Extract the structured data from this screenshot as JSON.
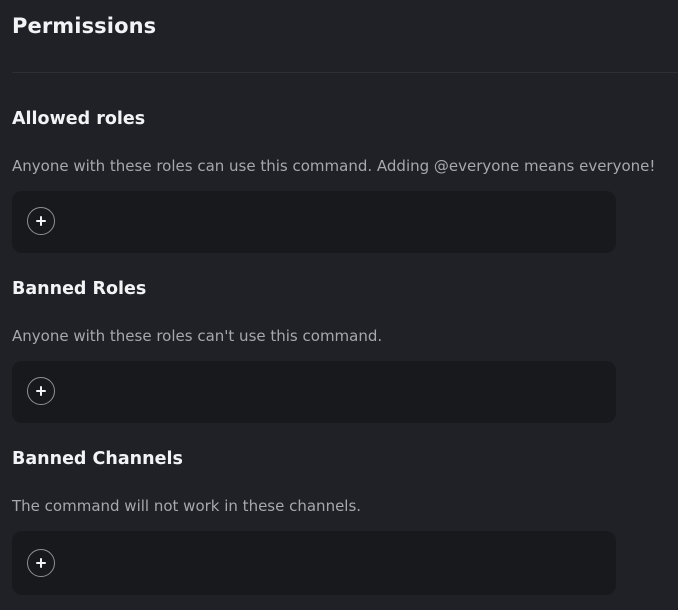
{
  "page": {
    "title": "Permissions"
  },
  "sections": [
    {
      "title": "Allowed roles",
      "description": "Anyone with these roles can use this command. Adding @everyone means everyone!",
      "add_icon": "plus-icon"
    },
    {
      "title": "Banned Roles",
      "description": "Anyone with these roles can't use this command.",
      "add_icon": "plus-icon"
    },
    {
      "title": "Banned Channels",
      "description": "The command will not work in these channels.",
      "add_icon": "plus-icon"
    }
  ],
  "colors": {
    "background": "#1f2126",
    "box": "#18191d",
    "text": "#f2f3f5",
    "muted_text": "#a6a8ad",
    "divider": "#2c2f35"
  }
}
